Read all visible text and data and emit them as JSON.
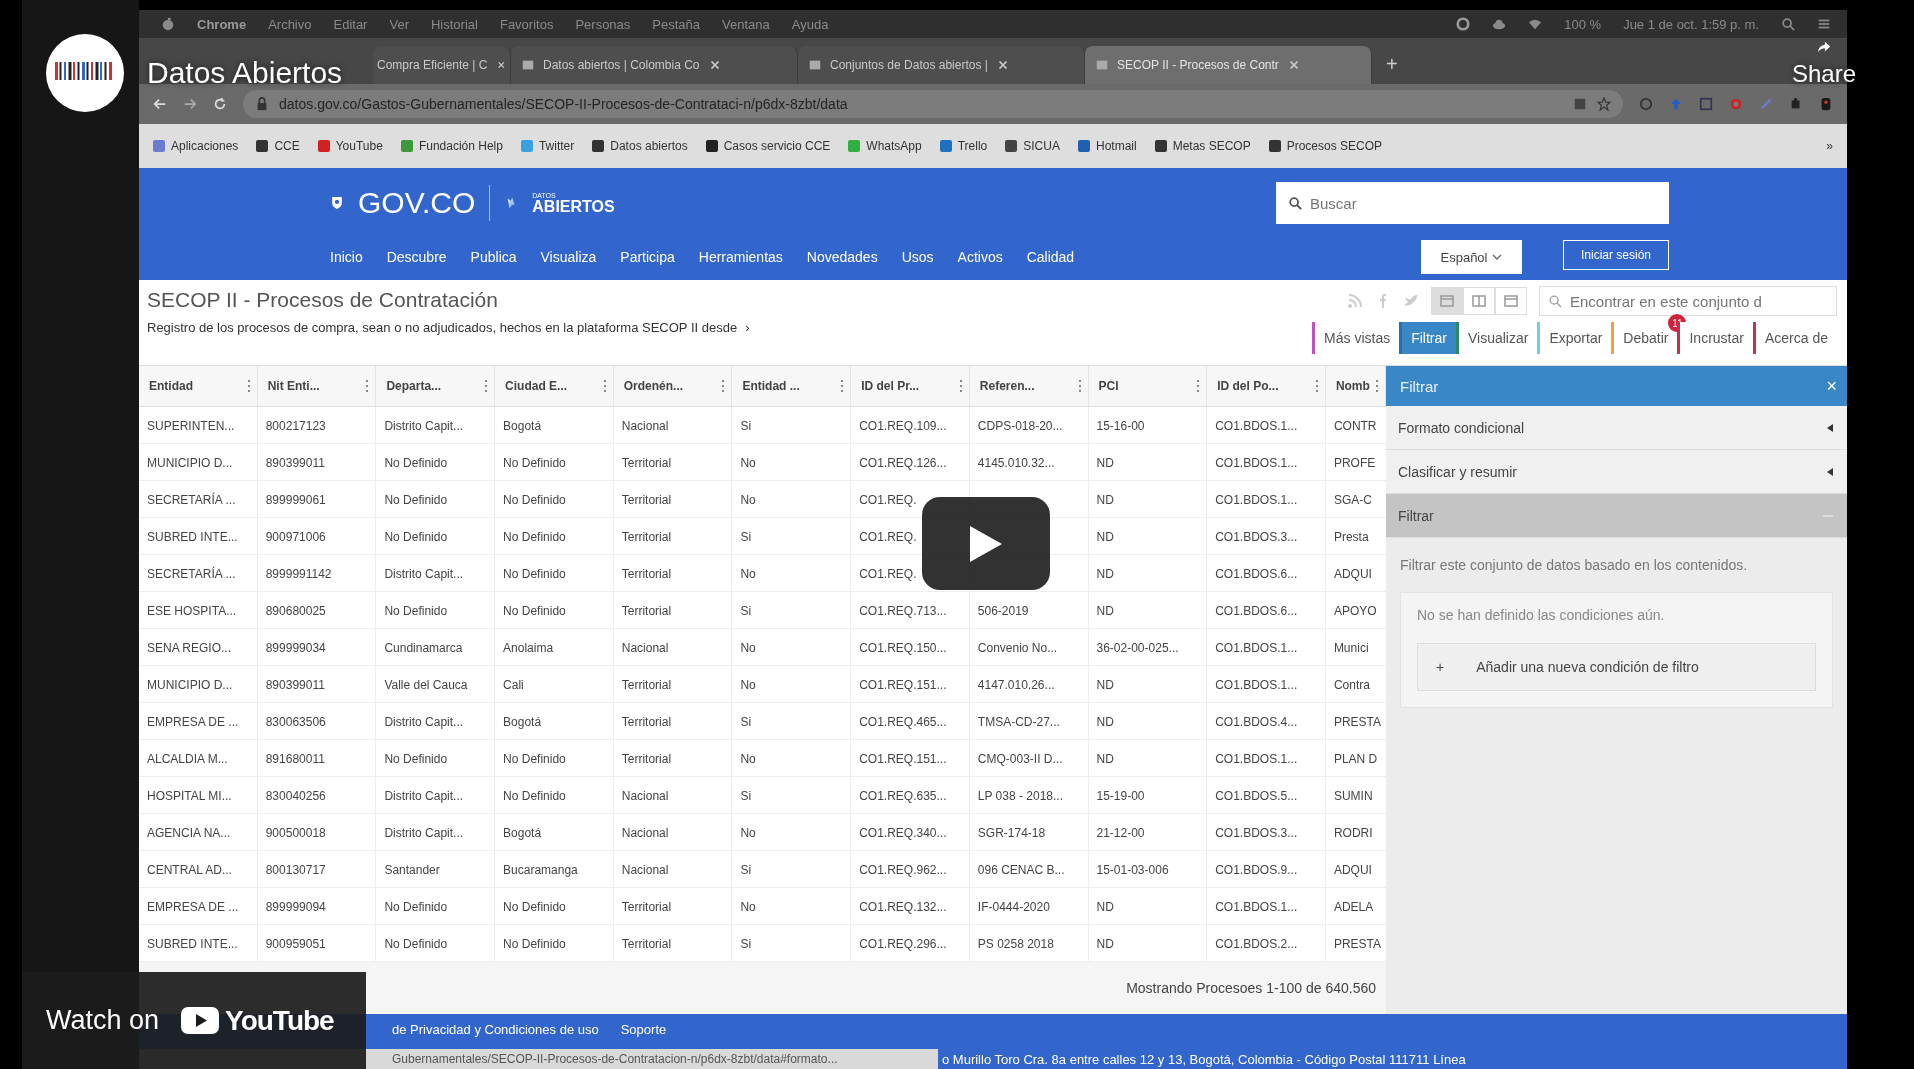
{
  "video": {
    "title": "Datos Abiertos",
    "share_label": "Share",
    "watch_label": "Watch on",
    "youtube_label": "YouTube"
  },
  "menu_bar": {
    "items": [
      "Chrome",
      "Archivo",
      "Editar",
      "Ver",
      "Historial",
      "Favoritos",
      "Personas",
      "Pestaña",
      "Ventana",
      "Ayuda"
    ],
    "battery": "100 %",
    "clock": "Jue 1 de oct. 1:59 p. m."
  },
  "browser": {
    "tabs": [
      {
        "title": "Compra Eficiente | C",
        "selected": false
      },
      {
        "title": "Datos abiertos | Colombia Co",
        "selected": false
      },
      {
        "title": "Conjuntos de Datos abiertos |",
        "selected": false
      },
      {
        "title": "SECOP II - Procesos de Contr",
        "selected": true
      }
    ],
    "new_tab": "+",
    "url": "datos.gov.co/Gastos-Gubernamentales/SECOP-II-Procesos-de-Contrataci-n/p6dx-8zbt/data",
    "bookmarks": [
      {
        "label": "Aplicaciones",
        "color": "#6a7bd0"
      },
      {
        "label": "CCE",
        "color": "#333333"
      },
      {
        "label": "YouTube",
        "color": "#d02020"
      },
      {
        "label": "Fundación Help",
        "color": "#3a9a3a"
      },
      {
        "label": "Twitter",
        "color": "#3aa0e0"
      },
      {
        "label": "Datos abiertos",
        "color": "#333333"
      },
      {
        "label": "Casos servicio CCE",
        "color": "#222222"
      },
      {
        "label": "WhatsApp",
        "color": "#30b040"
      },
      {
        "label": "Trello",
        "color": "#2070c0"
      },
      {
        "label": "SICUA",
        "color": "#444444"
      },
      {
        "label": "Hotmail",
        "color": "#2060b0"
      },
      {
        "label": "Metas SECOP",
        "color": "#333333"
      },
      {
        "label": "Procesos SECOP",
        "color": "#333333"
      }
    ],
    "bookmarks_more": "»"
  },
  "site_header": {
    "logo": "GOV.CO",
    "brand_top": "DATOS",
    "brand_bottom": "ABIERTOS",
    "search_placeholder": "Buscar",
    "nav": [
      "Inicio",
      "Descubre",
      "Publica",
      "Visualiza",
      "Participa",
      "Herramientas",
      "Novedades",
      "Usos",
      "Activos",
      "Calidad"
    ],
    "language": "Español",
    "login": "Iniciar sesión"
  },
  "dataset": {
    "title": "SECOP II - Procesos de Contratación",
    "description": "Registro de los procesos de compra, sean o no adjudicados, hechos en la plataforma SECOP II desde",
    "more": "›",
    "view_modes": [
      {
        "selected": true
      },
      {
        "selected": false
      },
      {
        "selected": false
      }
    ],
    "search_placeholder": "Encontrar en este conjunto d",
    "actions": [
      {
        "label": "Más vistas",
        "color": "#c050c0",
        "selected": false
      },
      {
        "label": "Filtrar",
        "color": "#2a6fa8",
        "selected": true
      },
      {
        "label": "Visualizar",
        "color": "#2a8a5a",
        "selected": false
      },
      {
        "label": "Exportar",
        "color": "#70d0e0",
        "selected": false
      },
      {
        "label": "Debatir",
        "color": "#f0a040",
        "selected": false,
        "badge": "11"
      },
      {
        "label": "Incrustar",
        "color": "#c03050",
        "selected": false
      },
      {
        "label": "Acerca de",
        "color": "#c03050",
        "selected": false
      }
    ]
  },
  "table": {
    "columns": [
      "Entidad",
      "Nit Enti...",
      "Departa...",
      "Ciudad E...",
      "Ordenén...",
      "Entidad ...",
      "ID del Pr...",
      "Referen...",
      "PCI",
      "ID del Po...",
      "Nomb"
    ],
    "rows": [
      [
        "SUPERINTEN...",
        "800217123",
        "Distrito Capit...",
        "Bogotá",
        "Nacional",
        "Si",
        "CO1.REQ.109...",
        "CDPS-018-20...",
        "15-16-00",
        "CO1.BDOS.1...",
        "CONTR"
      ],
      [
        "MUNICIPIO D...",
        "890399011",
        "No Definido",
        "No Definido",
        "Territorial",
        "No",
        "CO1.REQ.126...",
        "4145.010.32...",
        "ND",
        "CO1.BDOS.1...",
        "PROFE"
      ],
      [
        "SECRETARÍA ...",
        "899999061",
        "No Definido",
        "No Definido",
        "Territorial",
        "No",
        "CO1.REQ.",
        null,
        "ND",
        "CO1.BDOS.1...",
        "SGA-C"
      ],
      [
        "SUBRED INTE...",
        "900971006",
        "No Definido",
        "No Definido",
        "Territorial",
        "Si",
        "CO1.REQ.",
        null,
        "ND",
        "CO1.BDOS.3...",
        "Presta"
      ],
      [
        "SECRETARÍA ...",
        "8999991142",
        "Distrito Capit...",
        "No Definido",
        "Territorial",
        "No",
        "CO1.REQ.",
        null,
        "ND",
        "CO1.BDOS.6...",
        "ADQUI"
      ],
      [
        "ESE HOSPITA...",
        "890680025",
        "No Definido",
        "No Definido",
        "Territorial",
        "Si",
        "CO1.REQ.713...",
        "506-2019",
        "ND",
        "CO1.BDOS.6...",
        "APOYO"
      ],
      [
        "SENA REGIO...",
        "899999034",
        "Cundinamarca",
        "Anolaima",
        "Nacional",
        "No",
        "CO1.REQ.150...",
        "Convenio No...",
        "36-02-00-025...",
        "CO1.BDOS.1...",
        "Munici"
      ],
      [
        "MUNICIPIO D...",
        "890399011",
        "Valle del Cauca",
        "Cali",
        "Territorial",
        "No",
        "CO1.REQ.151...",
        "4147.010.26...",
        "ND",
        "CO1.BDOS.1...",
        "Contra"
      ],
      [
        "EMPRESA DE ...",
        "830063506",
        "Distrito Capit...",
        "Bogotá",
        "Territorial",
        "Si",
        "CO1.REQ.465...",
        "TMSA-CD-27...",
        "ND",
        "CO1.BDOS.4...",
        "PRESTA"
      ],
      [
        "ALCALDIA M...",
        "891680011",
        "No Definido",
        "No Definido",
        "Territorial",
        "No",
        "CO1.REQ.151...",
        "CMQ-003-II D...",
        "ND",
        "CO1.BDOS.1...",
        "PLAN D"
      ],
      [
        "HOSPITAL MI...",
        "830040256",
        "Distrito Capit...",
        "No Definido",
        "Nacional",
        "Si",
        "CO1.REQ.635...",
        "LP 038 - 2018...",
        "15-19-00",
        "CO1.BDOS.5...",
        "SUMIN"
      ],
      [
        "AGENCIA NA...",
        "900500018",
        "Distrito Capit...",
        "Bogotá",
        "Nacional",
        "No",
        "CO1.REQ.340...",
        "SGR-174-18",
        "21-12-00",
        "CO1.BDOS.3...",
        "RODRI"
      ],
      [
        "CENTRAL AD...",
        "800130717",
        "Santander",
        "Bucaramanga",
        "Nacional",
        "Si",
        "CO1.REQ.962...",
        "096 CENAC B...",
        "15-01-03-006",
        "CO1.BDOS.9...",
        "ADQUI"
      ],
      [
        "EMPRESA DE ...",
        "899999094",
        "No Definido",
        "No Definido",
        "Territorial",
        "No",
        "CO1.REQ.132...",
        "IF-0444-2020",
        "ND",
        "CO1.BDOS.1...",
        "ADELA"
      ],
      [
        "SUBRED INTE...",
        "900959051",
        "No Definido",
        "No Definido",
        "Territorial",
        "Si",
        "CO1.REQ.296...",
        "PS 0258 2018",
        "ND",
        "CO1.BDOS.2...",
        "PRESTA"
      ]
    ],
    "pagination": "Mostrando Procesoes 1-100 de 640.560"
  },
  "filter_panel": {
    "title": "Filtrar",
    "close": "×",
    "sections": [
      {
        "label": "Formato condicional",
        "expanded": false
      },
      {
        "label": "Clasificar y resumir",
        "expanded": false
      },
      {
        "label": "Filtrar",
        "expanded": true
      }
    ],
    "description": "Filtrar este conjunto de datos basado en los contenidos.",
    "empty_message": "No se han definido las condiciones aún.",
    "add_icon": "+",
    "add_button": "Añadir una nueva condición de filtro"
  },
  "footer": {
    "links": [
      "de Privacidad y Condiciones de uso",
      "Soporte"
    ],
    "status_url": "Gubernamentales/SECOP-II-Procesos-de-Contratacion-n/p6dx-8zbt/data#formato...",
    "address": "o Murillo Toro Cra. 8a entre calles 12 y 13, Bogotá, Colombia - Código Postal 111711 Línea"
  }
}
